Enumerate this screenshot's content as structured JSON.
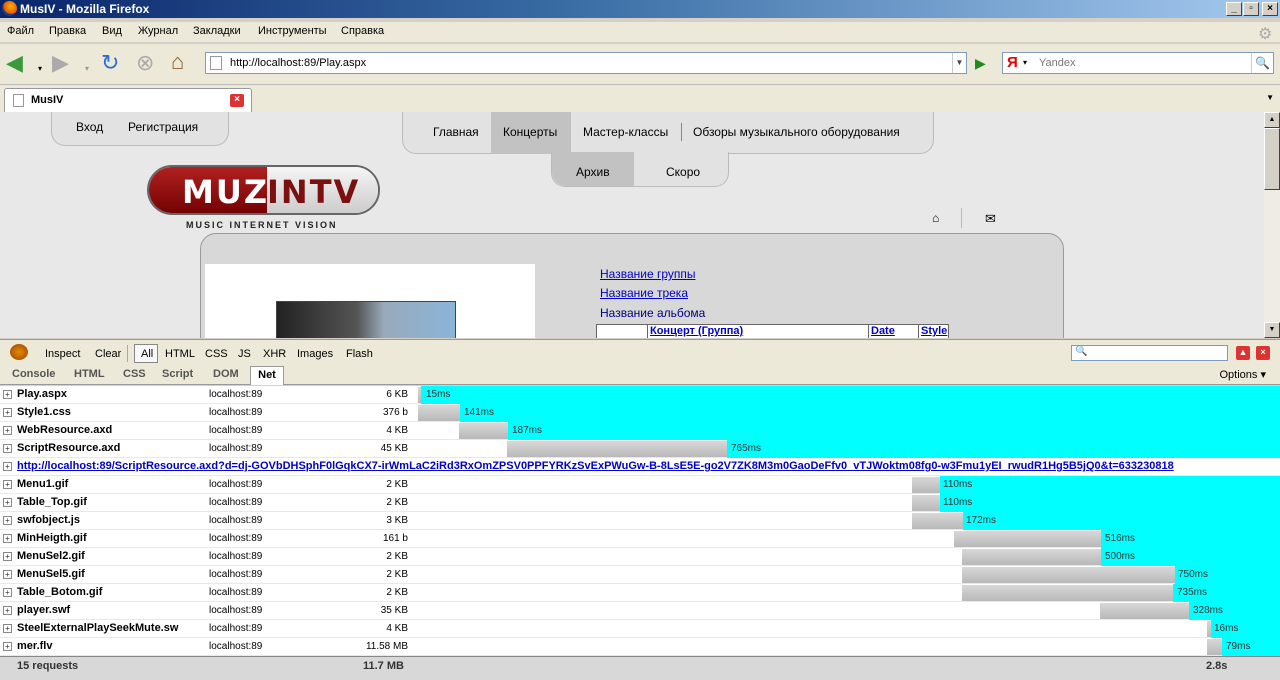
{
  "window": {
    "title": "MusIV - Mozilla Firefox"
  },
  "menu": [
    "Файл",
    "Правка",
    "Вид",
    "Журнал",
    "Закладки",
    "Инструменты",
    "Справка"
  ],
  "address": {
    "url": "http://localhost:89/Play.aspx"
  },
  "search": {
    "placeholder": "Yandex",
    "engine_glyph": "Я"
  },
  "tab": {
    "title": "MusIV"
  },
  "site": {
    "login": "Вход",
    "register": "Регистрация",
    "nav": [
      "Главная",
      "Концерты",
      "Мастер-классы",
      "Обзоры музыкального оборудования"
    ],
    "subnav": [
      "Архив",
      "Скоро"
    ],
    "logo_left": "MUZ",
    "logo_right": "INTV",
    "logo_sub": "MUSIC INTERNET VISION",
    "link_group": "Название группы",
    "link_track": "Название трека",
    "album": "Название альбома",
    "table_headers": [
      "Концерт (Группа)",
      "Date",
      "Style"
    ]
  },
  "firebug": {
    "toolbar": [
      "Inspect",
      "Clear",
      "All",
      "HTML",
      "CSS",
      "JS",
      "XHR",
      "Images",
      "Flash"
    ],
    "tabs": [
      "Console",
      "HTML",
      "CSS",
      "Script",
      "DOM",
      "Net"
    ],
    "options": "Options ▾",
    "requests": [
      {
        "name": "Play.aspx",
        "domain": "localhost:89",
        "size": "6 KB",
        "time": "15ms"
      },
      {
        "name": "Style1.css",
        "domain": "localhost:89",
        "size": "376 b",
        "time": "141ms"
      },
      {
        "name": "WebResource.axd",
        "domain": "localhost:89",
        "size": "4 KB",
        "time": "187ms"
      },
      {
        "name": "ScriptResource.axd",
        "domain": "localhost:89",
        "size": "45 KB",
        "time": "765ms"
      },
      {
        "name": "http://localhost:89/ScriptResource.axd?d=dj-GOVbDHSphF0lGqkCX7-irWmLaC2iRd3RxOmZPSV0PPFYRKzSvExPWuGw-B-8LsE5E-go2V7ZK8M3m0GaoDeFfv0_vTJWoktm08fg0-w3Fmu1yEI_rwudR1Hg5B5jQ0&t=633230818",
        "url": true
      },
      {
        "name": "Menu1.gif",
        "domain": "localhost:89",
        "size": "2 KB",
        "time": "110ms"
      },
      {
        "name": "Table_Top.gif",
        "domain": "localhost:89",
        "size": "2 KB",
        "time": "110ms"
      },
      {
        "name": "swfobject.js",
        "domain": "localhost:89",
        "size": "3 KB",
        "time": "172ms"
      },
      {
        "name": "MinHeigth.gif",
        "domain": "localhost:89",
        "size": "161 b",
        "time": "516ms"
      },
      {
        "name": "MenuSel2.gif",
        "domain": "localhost:89",
        "size": "2 KB",
        "time": "500ms"
      },
      {
        "name": "MenuSel5.gif",
        "domain": "localhost:89",
        "size": "2 KB",
        "time": "750ms"
      },
      {
        "name": "Table_Botom.gif",
        "domain": "localhost:89",
        "size": "2 KB",
        "time": "735ms"
      },
      {
        "name": "player.swf",
        "domain": "localhost:89",
        "size": "35 KB",
        "time": "328ms"
      },
      {
        "name": "SteelExternalPlaySeekMute.sw",
        "domain": "localhost:89",
        "size": "4 KB",
        "time": "16ms"
      },
      {
        "name": "mer.flv",
        "domain": "localhost:89",
        "size": "11.58 MB",
        "time": "79ms"
      }
    ],
    "summary": {
      "requests": "15 requests",
      "total_size": "11.7 MB",
      "total_time": "2.8s"
    }
  }
}
